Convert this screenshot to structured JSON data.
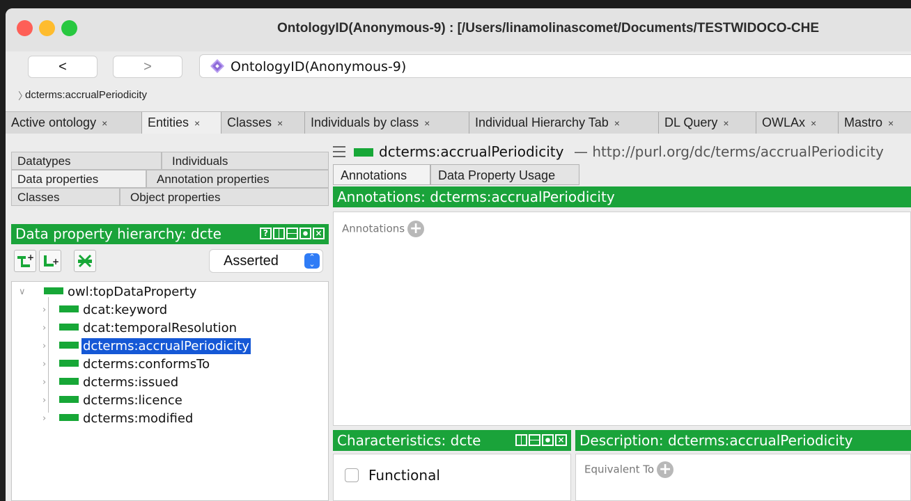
{
  "window": {
    "title": "OntologyID(Anonymous-9) : [/Users/linamolinascomet/Documents/TESTWIDOCO-CHE"
  },
  "nav": {
    "back_label": "<",
    "forward_label": ">",
    "address": "OntologyID(Anonymous-9)"
  },
  "breadcrumb": {
    "text": "dcterms:accrualPeriodicity"
  },
  "tabs": [
    {
      "label": "Active ontology",
      "close": "×"
    },
    {
      "label": "Entities",
      "close": "×"
    },
    {
      "label": "Classes",
      "close": "×"
    },
    {
      "label": "Individuals by class",
      "close": "×"
    },
    {
      "label": "Individual Hierarchy Tab",
      "close": "×"
    },
    {
      "label": "DL Query",
      "close": "×"
    },
    {
      "label": "OWLAx",
      "close": "×"
    },
    {
      "label": "Mastro",
      "close": "×"
    }
  ],
  "entity_tabs": {
    "datatypes": "Datatypes",
    "individuals": "Individuals",
    "data_properties": "Data properties",
    "annotation_properties": "Annotation properties",
    "classes": "Classes",
    "object_properties": "Object properties"
  },
  "hierarchy": {
    "title": "Data property hierarchy: dcte",
    "mode": "Asserted",
    "root": "owl:topDataProperty",
    "items": [
      "dcat:keyword",
      "dcat:temporalResolution",
      "dcterms:accrualPeriodicity",
      "dcterms:conformsTo",
      "dcterms:issued",
      "dcterms:licence",
      "dcterms:modified"
    ]
  },
  "entity": {
    "name": "dcterms:accrualPeriodicity",
    "iri": "— http://purl.org/dc/terms/accrualPeriodicity"
  },
  "right_tabs": {
    "annotations": "Annotations",
    "usage": "Data Property Usage"
  },
  "annotations": {
    "header": "Annotations: dcterms:accrualPeriodicity",
    "add_label": "Annotations"
  },
  "characteristics": {
    "header": "Characteristics: dcte",
    "functional": "Functional"
  },
  "description": {
    "header": "Description: dcterms:accrualPeriodicity",
    "equivalent_label": "Equivalent To"
  },
  "colors": {
    "accent_green": "#1aa33a",
    "selection_blue": "#1558d6"
  }
}
